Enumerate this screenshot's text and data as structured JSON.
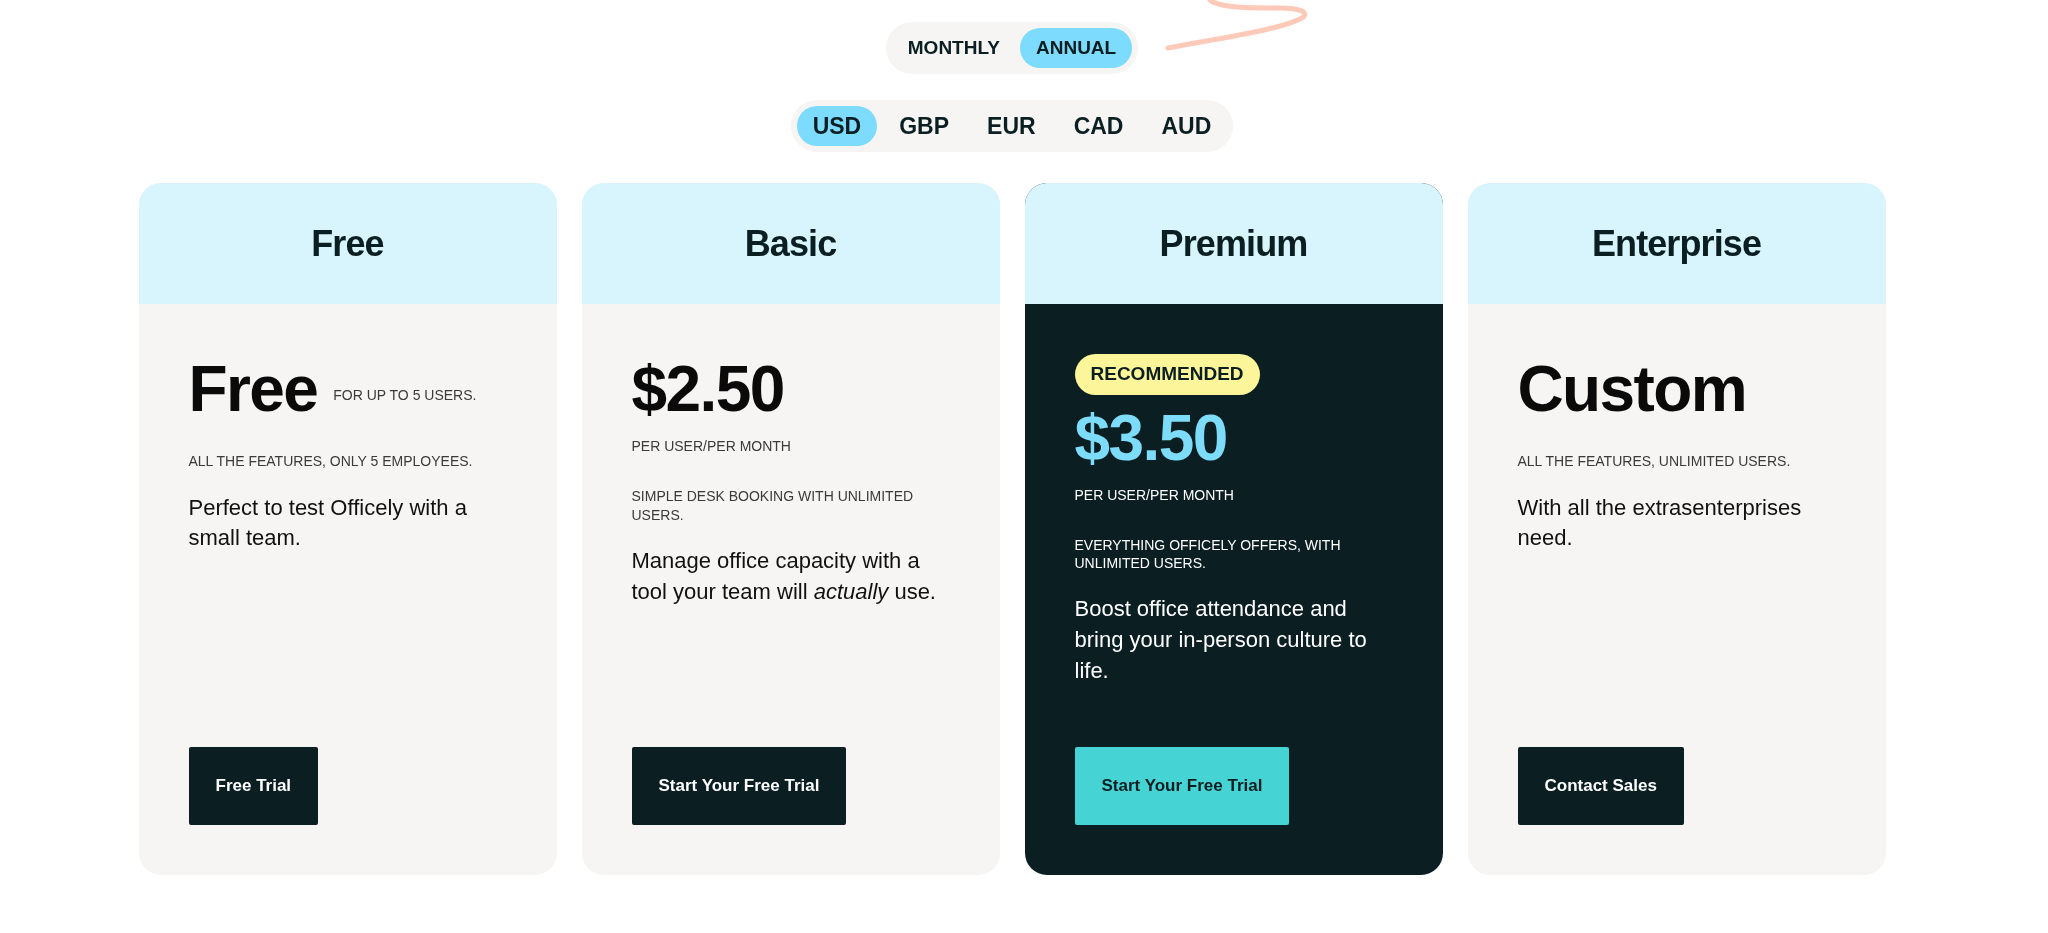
{
  "billing_toggle": [
    {
      "label": "MONTHLY",
      "selected": false
    },
    {
      "label": "ANNUAL",
      "selected": true
    }
  ],
  "currencies": [
    {
      "label": "USD",
      "selected": true
    },
    {
      "label": "GBP",
      "selected": false
    },
    {
      "label": "EUR",
      "selected": false
    },
    {
      "label": "CAD",
      "selected": false
    },
    {
      "label": "AUD",
      "selected": false
    }
  ],
  "plans": [
    {
      "name": "Free",
      "featured": false,
      "price": "Free",
      "price_note": {
        "text": "FOR UP TO 5 USERS.",
        "kind": "inline"
      },
      "tagline": "ALL THE FEATURES, ONLY 5 EMPLOYEES.",
      "description": "Perfect to test Officely with a small team.",
      "button": "Free Trial"
    },
    {
      "name": "Basic",
      "featured": false,
      "price": "$2.50",
      "price_note": {
        "text": "PER USER/PER MONTH",
        "kind": "below"
      },
      "tagline": "SIMPLE DESK BOOKING WITH UNLIMITED USERS.",
      "description": "Manage office capacity with a tool your team will *actually* use.",
      "button": "Start Your Free Trial"
    },
    {
      "name": "Premium",
      "featured": true,
      "badge": "RECOMMENDED",
      "price": "$3.50",
      "price_note": {
        "text": "PER USER/PER MONTH",
        "kind": "below"
      },
      "tagline": "EVERYTHING OFFICELY OFFERS, WITH UNLIMITED USERS.",
      "description": "Boost office attendance and bring your in-person culture to life.",
      "button": "Start Your Free Trial"
    },
    {
      "name": "Enterprise",
      "featured": false,
      "price": "Custom",
      "tagline": "ALL THE FEATURES, UNLIMITED USERS.",
      "description": "With all the extrasenterprises need.",
      "button": "Contact Sales"
    }
  ]
}
